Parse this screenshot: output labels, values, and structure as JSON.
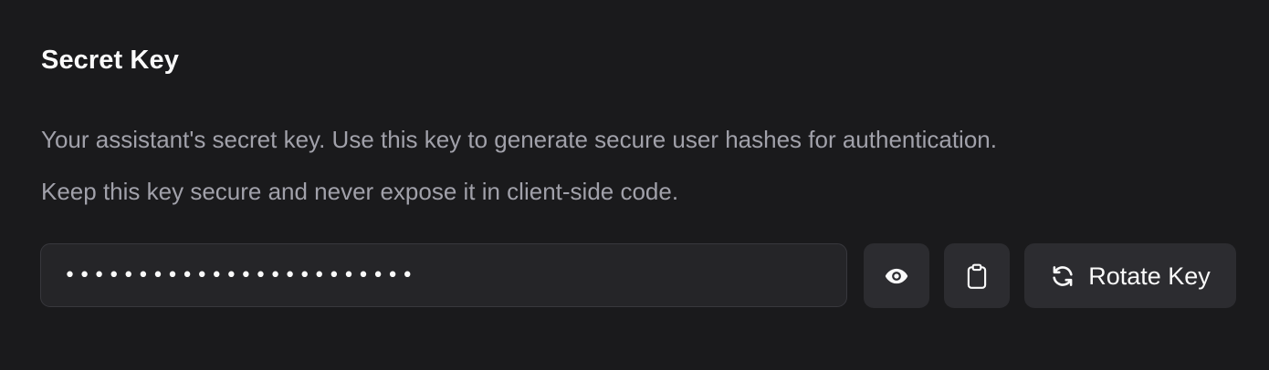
{
  "section": {
    "title": "Secret Key",
    "description_line1": "Your assistant's secret key. Use this key to generate secure user hashes for authentication.",
    "description_line2": "Keep this key secure and never expose it in client-side code."
  },
  "secret_key_field": {
    "value": "••••••••••••••••••••••••",
    "masked": true
  },
  "actions": {
    "toggle_visibility_icon": "eye-icon",
    "copy_icon": "clipboard-icon",
    "rotate_icon": "refresh-icon",
    "rotate_label": "Rotate Key"
  },
  "colors": {
    "background": "#1a1a1c",
    "input_background": "#252528",
    "button_background": "#2c2c30",
    "text_primary": "#fafafa",
    "text_muted": "#a1a1aa"
  }
}
